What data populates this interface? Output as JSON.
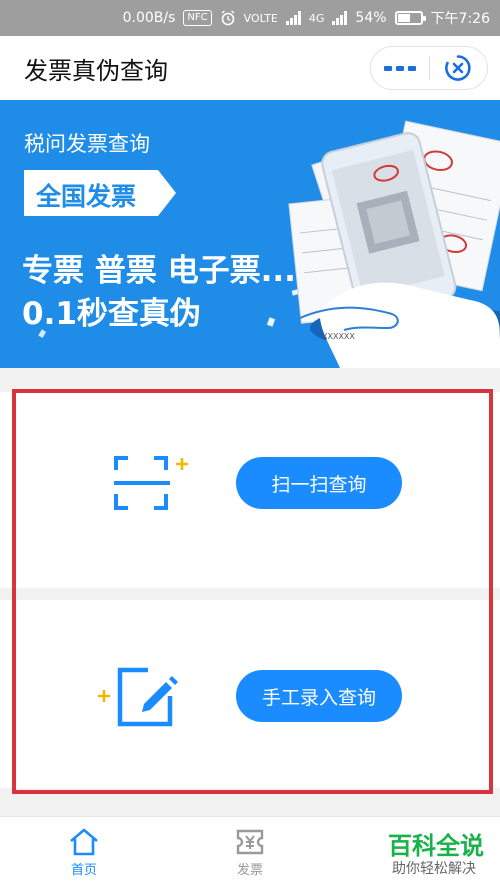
{
  "status_bar": {
    "speed": "0.00B/s",
    "nfc": "NFC",
    "volte": "VOLTE",
    "network": "4G",
    "battery": "54%",
    "battery_level": 0.54,
    "time": "下午7:26"
  },
  "header": {
    "title": "发票真伪查询"
  },
  "banner": {
    "subtitle": "税问发票查询",
    "tag": "全国发票",
    "line1": "专票 普票 电子票...",
    "line2": "0.1秒查真伪",
    "receipt_text": "XXXXXX",
    "colors": {
      "background": "#1f8ce8",
      "hand": "#2a7fd6",
      "phone": "#e8eef5"
    }
  },
  "actions": {
    "scan_label": "扫一扫查询",
    "manual_label": "手工录入查询"
  },
  "tabbar": {
    "home_label": "首页",
    "invoice_label": "发票"
  },
  "watermark": {
    "title": "百科全说",
    "subtitle": "助你轻松解决"
  },
  "colors": {
    "accent": "#1a8cff",
    "highlight_border": "#d7343e",
    "plus": "#f5b800",
    "tab_active": "#1a8cff",
    "tab_inactive": "#9a9a9a",
    "watermark_green": "#19b24a"
  }
}
